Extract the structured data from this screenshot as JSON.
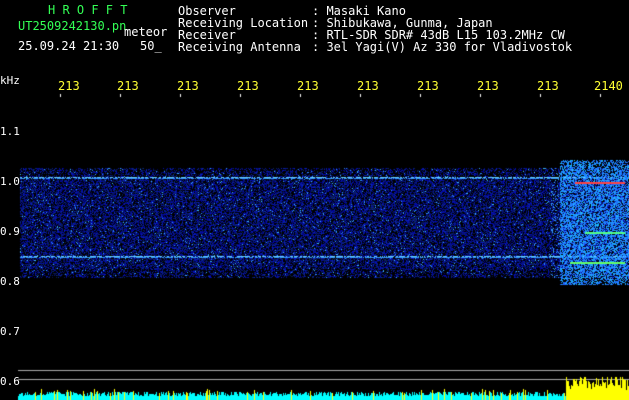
{
  "header": {
    "program": "H R O F F T",
    "filename": "UT2509242130.pn",
    "mode": "meteor",
    "datetime": "25.09.24 21:30",
    "count": "50_",
    "labels": [
      "Observer",
      "Receiving Location",
      "Receiver",
      "Receiving Antenna"
    ],
    "values": [
      ": Masaki Kano",
      ": Shibukawa, Gunma, Japan",
      ": RTL-SDR SDR# 43dB L15 103.2MHz CW",
      ": 3el Yagi(V) Az 330 for Vladivostok"
    ]
  },
  "axis": {
    "unit": "kHz",
    "y_ticks": [
      "1.1",
      "1.0",
      "0.9",
      "0.8",
      "0.7",
      "0.6"
    ],
    "x_ticks": [
      "213",
      "213",
      "213",
      "213",
      "213",
      "213",
      "213",
      "213",
      "213",
      "2140"
    ]
  },
  "colors": {
    "background": "#000000",
    "header_green": "#33ff55",
    "tick_yellow": "#ffff33",
    "signal_blue": "#2244ff",
    "bottom_bar": "#00ffff"
  }
}
